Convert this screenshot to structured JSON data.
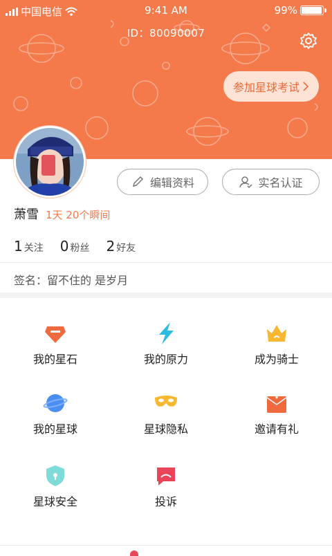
{
  "status_bar": {
    "carrier": "中国电信",
    "time": "9:41 AM",
    "battery": "99%"
  },
  "header": {
    "user_id": "ID：80090007",
    "exam_button": "参加星球考试",
    "bg_color": "#f47a4b"
  },
  "profile": {
    "edit_button": "编辑资料",
    "verify_button": "实名认证",
    "name": "萧雪",
    "days_moments": "1天 20个瞬间",
    "stats": [
      {
        "value": "1",
        "label": "关注"
      },
      {
        "value": "0",
        "label": "粉丝"
      },
      {
        "value": "2",
        "label": "好友"
      }
    ],
    "signature": "签名：留不住的 是岁月"
  },
  "menu": {
    "items": [
      {
        "label": "我的星石",
        "icon": "gem-icon"
      },
      {
        "label": "我的原力",
        "icon": "lightning-icon"
      },
      {
        "label": "成为骑士",
        "icon": "crown-icon"
      },
      {
        "label": "我的星球",
        "icon": "planet-icon"
      },
      {
        "label": "星球隐私",
        "icon": "mask-icon"
      },
      {
        "label": "邀请有礼",
        "icon": "gift-envelope-icon"
      },
      {
        "label": "星球安全",
        "icon": "shield-icon"
      },
      {
        "label": "投诉",
        "icon": "complaint-icon"
      }
    ]
  }
}
